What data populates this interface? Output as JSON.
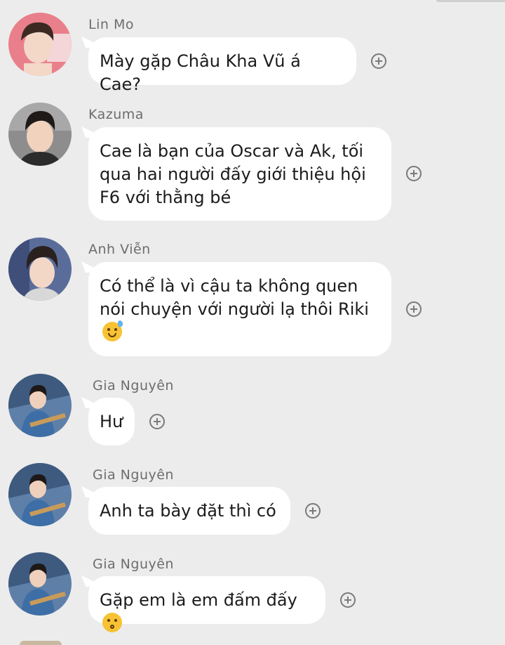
{
  "messages": [
    {
      "sender": "Lin Mo",
      "text": "Mày gặp Châu Kha Vũ á Cae?",
      "emoji": "",
      "avatar": "avatar-lin-mo"
    },
    {
      "sender": "Kazuma",
      "text": "Cae là bạn của Oscar và Ak, tối qua hai người đấy giới thiệu hội F6 với thằng bé",
      "emoji": "",
      "avatar": "avatar-kazuma"
    },
    {
      "sender": "Anh Viễn",
      "text": "Có thể là vì cậu ta không quen nói chuyện với người lạ thôi Riki",
      "emoji": "grinning-sweat-emoji",
      "avatar": "avatar-anh-vien"
    },
    {
      "sender": "Gia Nguyên",
      "text": "Hư",
      "emoji": "",
      "avatar": "avatar-gia-nguyen"
    },
    {
      "sender": "Gia Nguyên",
      "text": "Anh ta bày đặt thì có",
      "emoji": "",
      "avatar": "avatar-gia-nguyen"
    },
    {
      "sender": "Gia Nguyên",
      "text": "Gặp em là em đấm đấy",
      "emoji": "kissing-emoji",
      "avatar": "avatar-gia-nguyen"
    }
  ],
  "icons": {
    "react": "plus-circle-icon"
  },
  "colors": {
    "background": "#ececec",
    "bubble": "#ffffff",
    "name": "#6d6d6d"
  }
}
